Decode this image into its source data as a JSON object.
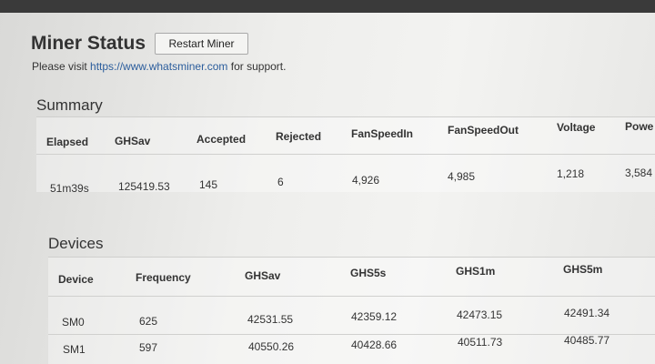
{
  "header": {
    "title": "Miner Status",
    "restart_label": "Restart Miner",
    "support_prefix": "Please visit ",
    "support_link": "https://www.whatsminer.com",
    "support_suffix": " for support."
  },
  "summary": {
    "title": "Summary",
    "columns": [
      "Elapsed",
      "GHSav",
      "Accepted",
      "Rejected",
      "FanSpeedIn",
      "FanSpeedOut",
      "Voltage",
      "Powe"
    ],
    "row": [
      "51m39s",
      "125419.53",
      "145",
      "6",
      "4,926",
      "4,985",
      "1,218",
      "3,584"
    ]
  },
  "devices": {
    "title": "Devices",
    "columns": [
      "Device",
      "Frequency",
      "GHSav",
      "GHS5s",
      "GHS1m",
      "GHS5m"
    ],
    "rows": [
      [
        "SM0",
        "625",
        "42531.55",
        "42359.12",
        "42473.15",
        "42491.34"
      ],
      [
        "SM1",
        "597",
        "40550.26",
        "40428.66",
        "40511.73",
        "40485.77"
      ]
    ]
  }
}
